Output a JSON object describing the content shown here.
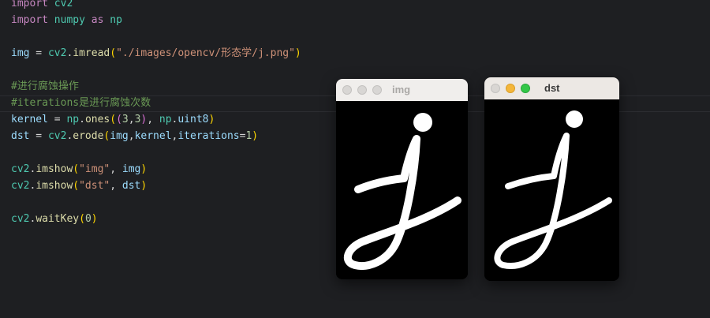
{
  "editor": {
    "line1": {
      "kw": "import",
      "mod": "cv2"
    },
    "line2": {
      "kw": "import",
      "mod": "numpy",
      "kw2": "as",
      "alias": "np"
    },
    "line4": {
      "var": "img",
      "eq": " = ",
      "mod": "cv2",
      "fn": "imread",
      "arg": "\"./images/opencv/形态学/j.png\""
    },
    "line6": {
      "comment": "#进行腐蚀操作"
    },
    "line7": {
      "comment": "#iterations是进行腐蚀次数"
    },
    "line8": {
      "var": "kernel",
      "eq": " = ",
      "mod": "np",
      "fn": "ones",
      "n1": "3",
      "n2": "3",
      "mod2": "np",
      "attr": "uint8"
    },
    "line9": {
      "var": "dst",
      "eq": " = ",
      "mod": "cv2",
      "fn": "erode",
      "a1": "img",
      "a2": "kernel",
      "a3": "iterations",
      "n": "1"
    },
    "line11": {
      "mod": "cv2",
      "fn": "imshow",
      "s": "\"img\"",
      "a": "img"
    },
    "line12": {
      "mod": "cv2",
      "fn": "imshow",
      "s": "\"dst\"",
      "a": "dst"
    },
    "line14": {
      "mod": "cv2",
      "fn": "waitKey",
      "n": "0"
    }
  },
  "windows": {
    "img": {
      "title": "img",
      "state": "inactive",
      "image": "white handwritten letter j on black (original)"
    },
    "dst": {
      "title": "dst",
      "state": "active",
      "image": "white handwritten letter j on black (eroded, thinner strokes)"
    }
  },
  "colors": {
    "editor_bg": "#1e1f22",
    "keyword": "#c586c0",
    "variable": "#9cdcfe",
    "module": "#4ec9b0",
    "function": "#dcdcaa",
    "string": "#ce9178",
    "number": "#b5cea8",
    "comment": "#6a9955",
    "titlebar": "#ece8e4",
    "yellow_light": "#f4b63a",
    "green_light": "#33c748"
  }
}
